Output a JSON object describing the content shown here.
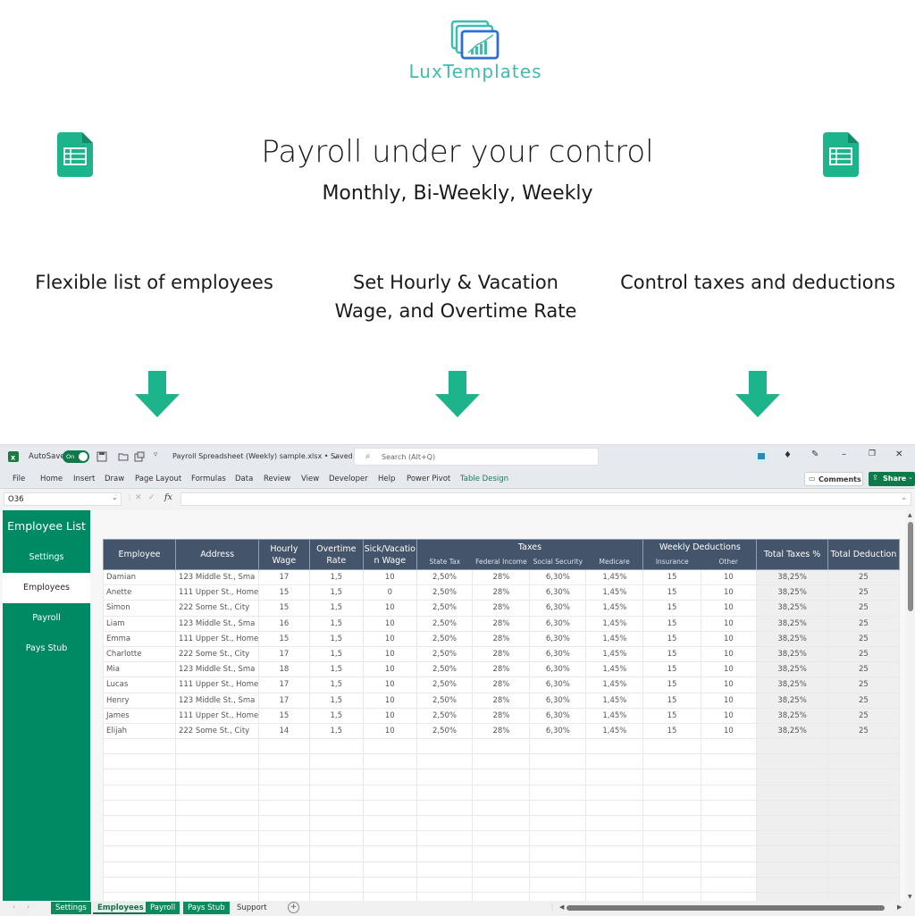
{
  "brand": {
    "name": "LuxTemplates",
    "color": "#3dbdb0"
  },
  "hero": {
    "headline": "Payroll under your control",
    "subline": "Monthly, Bi-Weekly, Weekly"
  },
  "features": [
    {
      "text": "Flexible list of employees"
    },
    {
      "line1": "Set Hourly & Vacation",
      "line2": "Wage, and Overtime Rate"
    },
    {
      "text": "Control taxes and deductions"
    }
  ],
  "colors": {
    "accent": "#1db38b",
    "excel_green": "#008a64",
    "header_slate": "#44546a"
  },
  "excel": {
    "autosave_label": "AutoSave",
    "autosave_state": "On",
    "file_title": "Payroll Spreadsheet (Weekly) sample.xlsx • Saved",
    "search_placeholder": "Search (Alt+Q)",
    "menu": [
      "File",
      "Home",
      "Insert",
      "Draw",
      "Page Layout",
      "Formulas",
      "Data",
      "Review",
      "View",
      "Developer",
      "Help",
      "Power Pivot",
      "Table Design"
    ],
    "comments_label": "Comments",
    "share_label": "Share",
    "name_box": "O36",
    "fx_label": "fx",
    "sidebar": {
      "title": "Employee List",
      "items": [
        "Settings",
        "Employees",
        "Payroll",
        "Pays Stub"
      ],
      "active": "Employees"
    },
    "table": {
      "headers": {
        "employee": "Employee",
        "address": "Address",
        "hourly_wage": "Hourly Wage",
        "overtime_rate": "Overtime Rate",
        "sick_vacation": "Sick/Vacation Wage",
        "taxes": "Taxes",
        "state_tax": "State Tax",
        "federal_income": "Federal Income",
        "social_security": "Social Security",
        "medicare": "Medicare",
        "weekly_deductions": "Weekly Deductions",
        "insurance": "Insurance",
        "other": "Other",
        "total_taxes": "Total Taxes %",
        "total_deduction": "Total Deduction"
      },
      "rows": [
        [
          "Damian",
          "123 Middle St., Sma",
          "17",
          "1,5",
          "10",
          "2,50%",
          "28%",
          "6,30%",
          "1,45%",
          "15",
          "10",
          "38,25%",
          "25"
        ],
        [
          "Anette",
          "111 Upper St., Home",
          "15",
          "1,5",
          "0",
          "2,50%",
          "28%",
          "6,30%",
          "1,45%",
          "15",
          "10",
          "38,25%",
          "25"
        ],
        [
          "Simon",
          "222 Some St., City",
          "15",
          "1,5",
          "10",
          "2,50%",
          "28%",
          "6,30%",
          "1,45%",
          "15",
          "10",
          "38,25%",
          "25"
        ],
        [
          "Liam",
          "123 Middle St., Sma",
          "16",
          "1,5",
          "10",
          "2,50%",
          "28%",
          "6,30%",
          "1,45%",
          "15",
          "10",
          "38,25%",
          "25"
        ],
        [
          "Emma",
          "111 Upper St., Home",
          "15",
          "1,5",
          "10",
          "2,50%",
          "28%",
          "6,30%",
          "1,45%",
          "15",
          "10",
          "38,25%",
          "25"
        ],
        [
          "Charlotte",
          "222 Some St., City",
          "17",
          "1,5",
          "10",
          "2,50%",
          "28%",
          "6,30%",
          "1,45%",
          "15",
          "10",
          "38,25%",
          "25"
        ],
        [
          "Mia",
          "123 Middle St., Sma",
          "18",
          "1,5",
          "10",
          "2,50%",
          "28%",
          "6,30%",
          "1,45%",
          "15",
          "10",
          "38,25%",
          "25"
        ],
        [
          "Lucas",
          "111 Upper St., Home",
          "17",
          "1,5",
          "10",
          "2,50%",
          "28%",
          "6,30%",
          "1,45%",
          "15",
          "10",
          "38,25%",
          "25"
        ],
        [
          "Henry",
          "123 Middle St., Sma",
          "17",
          "1,5",
          "10",
          "2,50%",
          "28%",
          "6,30%",
          "1,45%",
          "15",
          "10",
          "38,25%",
          "25"
        ],
        [
          "James",
          "111 Upper St., Home",
          "15",
          "1,5",
          "10",
          "2,50%",
          "28%",
          "6,30%",
          "1,45%",
          "15",
          "10",
          "38,25%",
          "25"
        ],
        [
          "Elijah",
          "222 Some St., City",
          "14",
          "1,5",
          "10",
          "2,50%",
          "28%",
          "6,30%",
          "1,45%",
          "15",
          "10",
          "38,25%",
          "25"
        ]
      ]
    },
    "sheet_tabs": [
      "Settings",
      "Employees",
      "Payroll",
      "Pays Stub",
      "Support"
    ],
    "active_tab": "Employees"
  }
}
